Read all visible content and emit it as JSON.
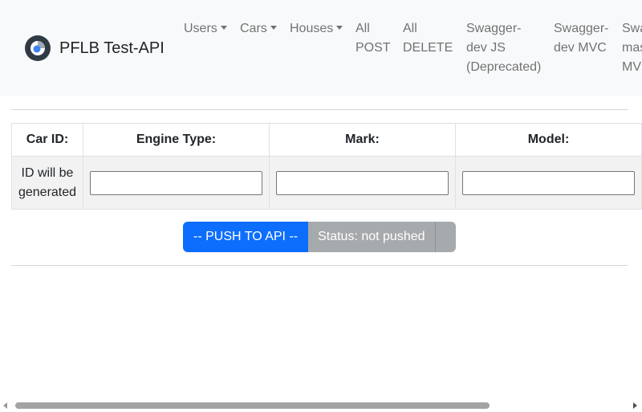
{
  "navbar": {
    "brand": "PFLB Test-API",
    "items": {
      "users": "Users",
      "cars": "Cars",
      "houses": "Houses",
      "all_post": [
        "All",
        "POST"
      ],
      "all_delete": [
        "All",
        "DELETE"
      ],
      "swagger_js": [
        "Swagger-",
        "dev JS",
        "(Deprecated)"
      ],
      "swagger_mvc": [
        "Swagger-",
        "dev MVC"
      ],
      "swagger_master": [
        "Swa",
        "mas",
        "MV"
      ]
    }
  },
  "table": {
    "headers": [
      "Car ID:",
      "Engine Type:",
      "Mark:",
      "Model:"
    ],
    "id_cell": [
      "ID will be",
      "generated"
    ],
    "inputs": {
      "engine_type": "",
      "mark": "",
      "model": ""
    }
  },
  "actions": {
    "push_label": "-- PUSH TO API --",
    "status_label": "Status: not pushed"
  },
  "colors": {
    "primary": "#0d6efd",
    "status_bg": "#a7aaad",
    "navbar_bg": "#f8f9fa"
  }
}
